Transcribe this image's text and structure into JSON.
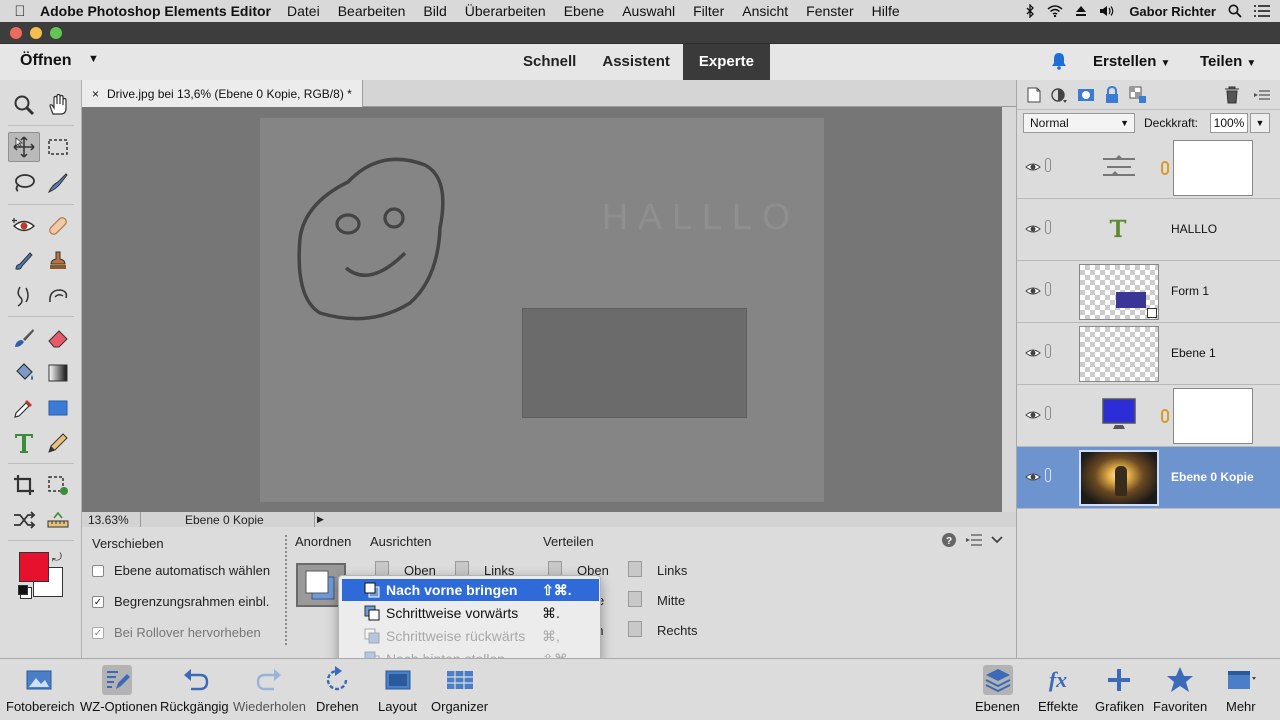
{
  "menubar": {
    "apple": "",
    "app_name": "Adobe Photoshop Elements Editor",
    "items": [
      "Datei",
      "Bearbeiten",
      "Bild",
      "Überarbeiten",
      "Ebene",
      "Auswahl",
      "Filter",
      "Ansicht",
      "Fenster",
      "Hilfe"
    ],
    "user": "Gabor Richter"
  },
  "topbar": {
    "open_label": "Öffnen",
    "modes": [
      "Schnell",
      "Assistent",
      "Experte"
    ],
    "active_mode": "Experte",
    "create_label": "Erstellen",
    "share_label": "Teilen"
  },
  "document": {
    "tab_title": "Drive.jpg bei 13,6% (Ebene 0 Kopie, RGB/8) *",
    "close_glyph": "×",
    "canvas_text": "HALLLO"
  },
  "status": {
    "zoom": "13.63%",
    "layer": "Ebene 0 Kopie"
  },
  "options": {
    "move_title": "Verschieben",
    "auto_select": "Ebene automatisch wählen",
    "auto_select_checked": false,
    "bounding_box": "Begrenzungsrahmen einbl.",
    "bounding_box_checked": true,
    "rollover": "Bei Rollover hervorheben",
    "rollover_checked": true,
    "arrange_title": "Anordnen",
    "align_title": "Ausrichten",
    "align_top": "Oben",
    "align_left": "Links",
    "align_partial_1": "e",
    "align_partial_2": "en",
    "distribute_title": "Verteilen",
    "distribute_top": "Oben",
    "distribute_left": "Links",
    "distribute_center": "Mitte",
    "distribute_right": "Rechts"
  },
  "arrange_menu": {
    "items": [
      {
        "label": "Nach vorne bringen",
        "shortcut": "⇧⌘.",
        "state": "highlighted"
      },
      {
        "label": "Schrittweise vorwärts",
        "shortcut": "⌘.",
        "state": "enabled"
      },
      {
        "label": "Schrittweise rückwärts",
        "shortcut": "⌘,",
        "state": "disabled"
      },
      {
        "label": "Nach hinten stellen",
        "shortcut": "⇧⌘,",
        "state": "disabled"
      }
    ]
  },
  "layers_panel": {
    "blend_mode": "Normal",
    "opacity_label": "Deckkraft:",
    "opacity_value": "100%",
    "layers": [
      {
        "name": "",
        "kind": "levels-adjustment",
        "has_mask": true
      },
      {
        "name": "HALLLO",
        "kind": "text",
        "has_mask": false
      },
      {
        "name": "Form 1",
        "kind": "shape",
        "has_mask": false
      },
      {
        "name": "Ebene 1",
        "kind": "pixel",
        "has_mask": false
      },
      {
        "name": "",
        "kind": "hue-adjustment",
        "has_mask": true
      },
      {
        "name": "Ebene 0 Kopie",
        "kind": "photo",
        "has_mask": false,
        "selected": true
      }
    ]
  },
  "bottombar": {
    "photo_bin": "Fotobereich",
    "tool_options": "WZ-Optionen",
    "undo": "Rückgängig",
    "redo": "Wiederholen",
    "rotate": "Drehen",
    "layout": "Layout",
    "organizer": "Organizer",
    "layers": "Ebenen",
    "effects": "Effekte",
    "graphics": "Grafiken",
    "favorites": "Favoriten",
    "more": "Mehr"
  },
  "colors": {
    "foreground": "#e8112d",
    "background": "#ffffff",
    "accent": "#2f6ad9",
    "selected_layer": "#6e94cf"
  }
}
